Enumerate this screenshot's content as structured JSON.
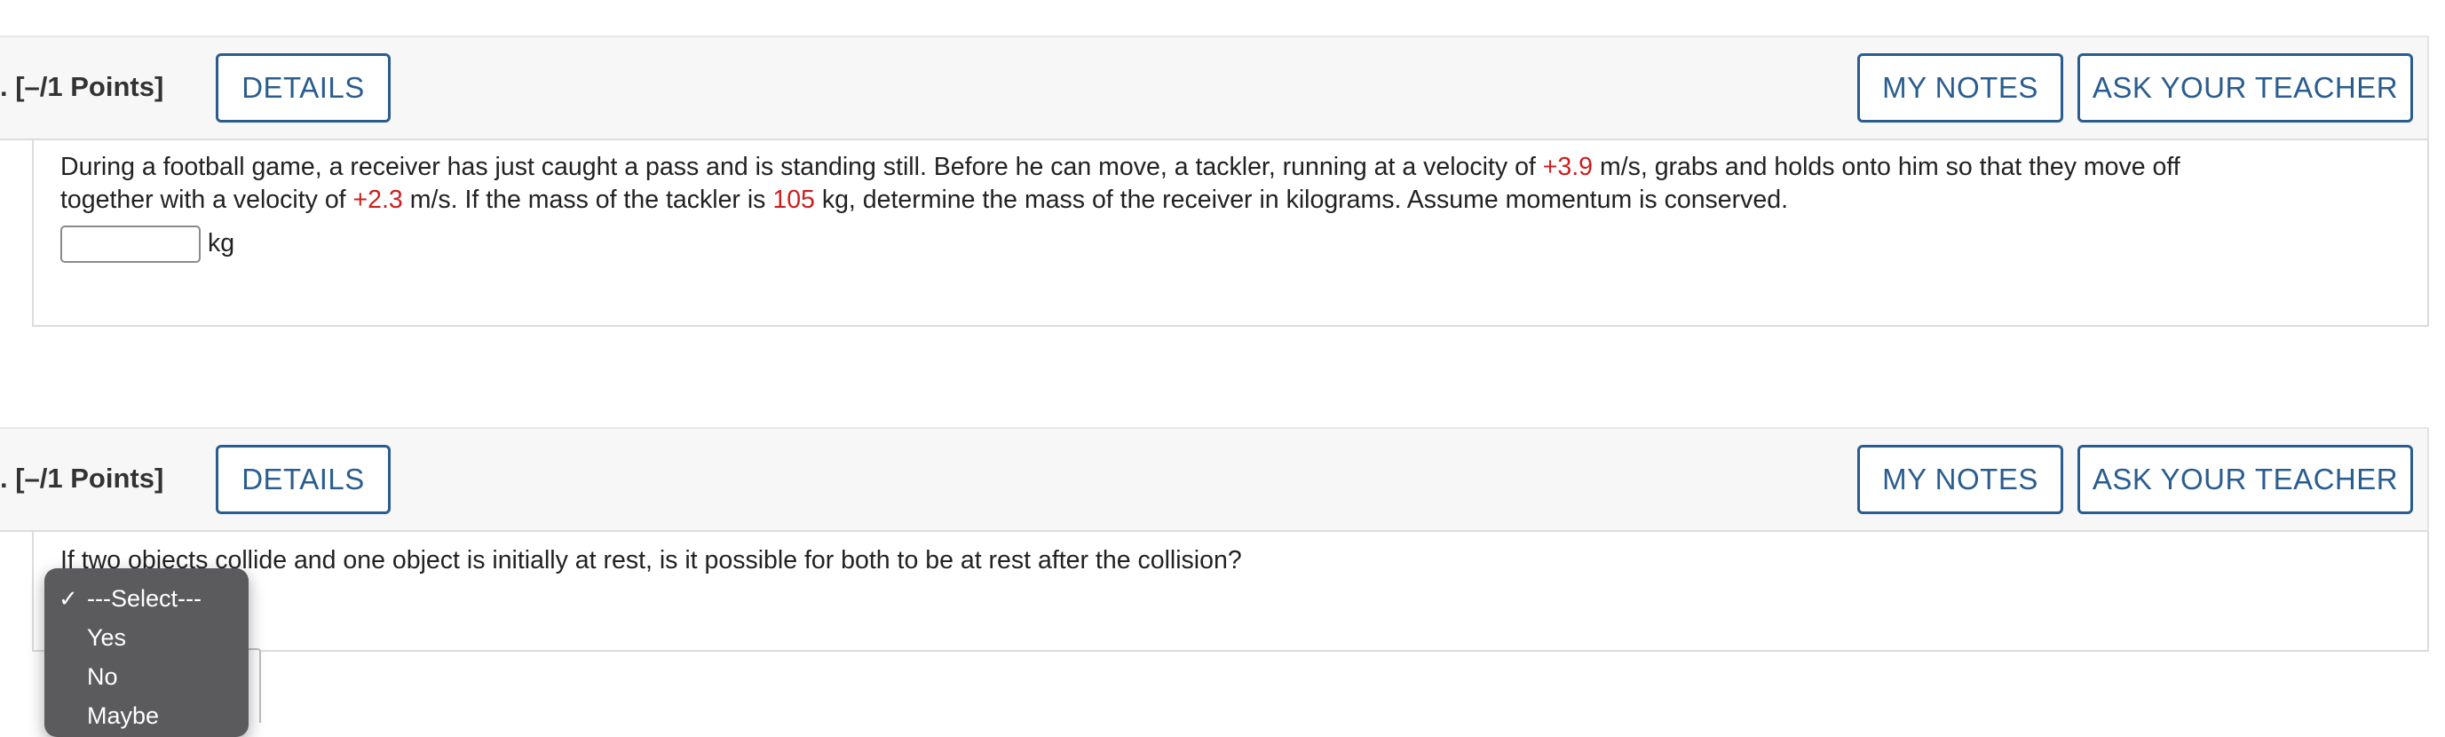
{
  "questions": [
    {
      "points_label": ". [–/1 Points]",
      "details_label": "DETAILS",
      "notes_label": "MY NOTES",
      "ask_label": "ASK YOUR TEACHER",
      "text_parts": {
        "p1": "During a football game, a receiver has just caught a pass and is standing still. Before he can move, a tackler, running at a velocity of ",
        "v1": "+3.9",
        "p2": " m/s, grabs and holds onto him so that they move off",
        "p3": "together with a velocity of ",
        "v2": "+2.3",
        "p4": " m/s. If the mass of the tackler is ",
        "m1": "105",
        "p5": " kg, determine the mass of the receiver in kilograms. Assume momentum is conserved."
      },
      "answer_value": "",
      "unit": "kg"
    },
    {
      "points_label": ". [–/1 Points]",
      "details_label": "DETAILS",
      "notes_label": "MY NOTES",
      "ask_label": "ASK YOUR TEACHER",
      "text": "If two objects collide and one object is initially at rest, is it possible for both to be at rest after the collision?",
      "select": {
        "selected": "---Select---",
        "options": [
          "---Select---",
          "Yes",
          "No",
          "Maybe"
        ]
      }
    }
  ],
  "colors": {
    "accent": "#2a5d8f",
    "highlight_red": "#cc1f1f",
    "menu_bg": "#5b5b5e"
  },
  "icons": {
    "check": "checkmark-icon"
  }
}
